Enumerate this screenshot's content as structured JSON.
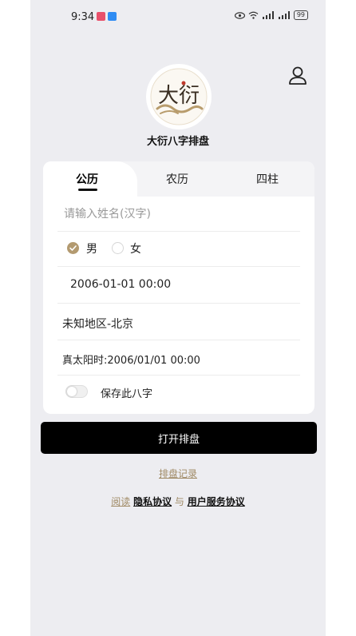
{
  "status_bar": {
    "time": "9:34",
    "battery": "99"
  },
  "app": {
    "name": "大衍八字排盘",
    "logo_text": "大衍"
  },
  "tabs": [
    {
      "label": "公历",
      "active": true
    },
    {
      "label": "农历",
      "active": false
    },
    {
      "label": "四柱",
      "active": false
    }
  ],
  "form": {
    "name_placeholder": "请输入姓名(汉字)",
    "gender": {
      "male": "男",
      "female": "女",
      "selected": "男"
    },
    "birth_datetime": "2006-01-01 00:00",
    "location": "未知地区-北京",
    "true_solar_time": "真太阳时:2006/01/01 00:00",
    "save_label": "保存此八字",
    "save_enabled": false
  },
  "actions": {
    "open_button": "打开排盘",
    "records_link": "排盘记录"
  },
  "agreement": {
    "read": "阅读",
    "privacy": "隐私协议",
    "and": "与",
    "terms": "用户服务协议"
  },
  "colors": {
    "accent": "#b39a70",
    "primary_button": "#000000",
    "background": "#ededf1"
  }
}
